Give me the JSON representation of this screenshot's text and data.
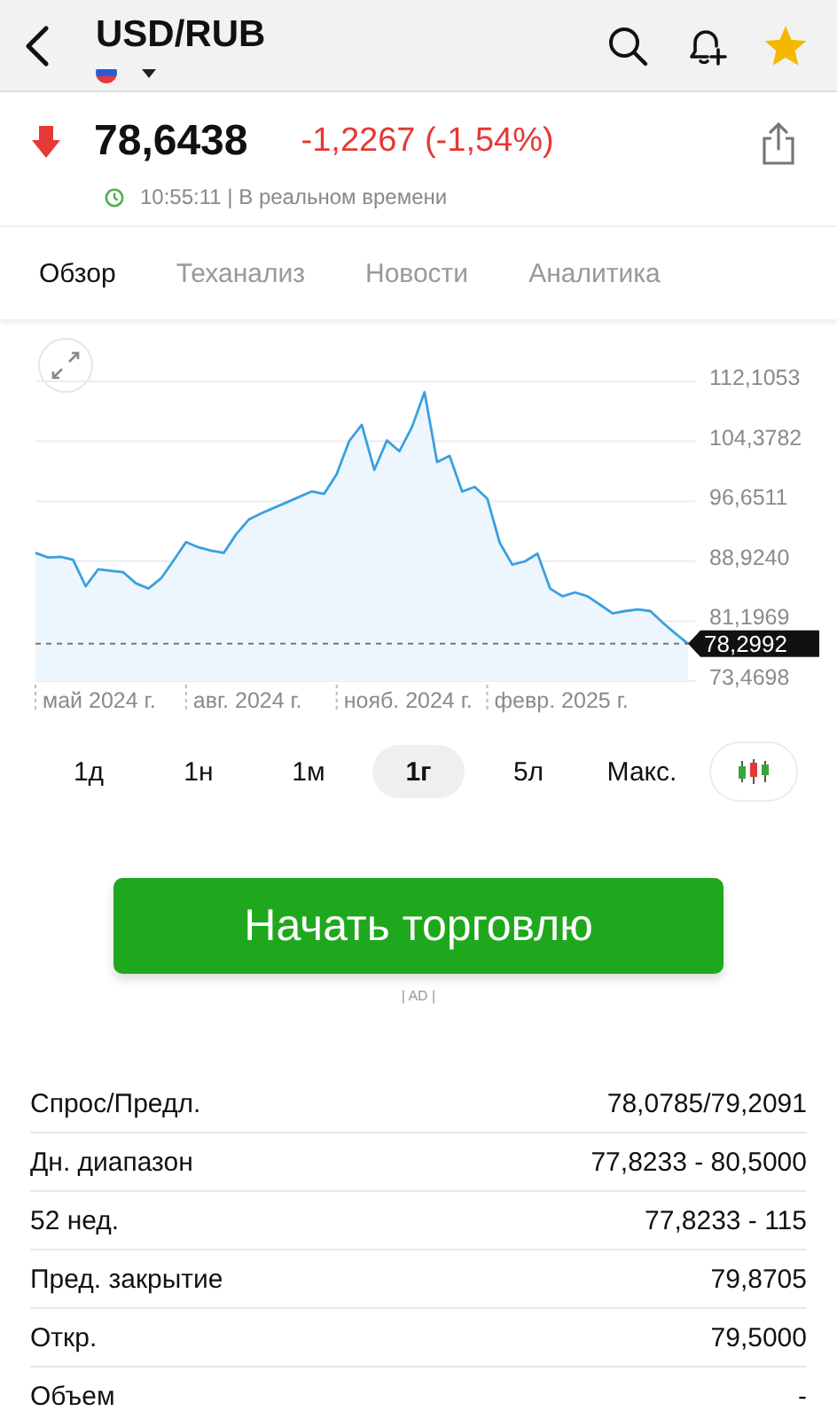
{
  "header": {
    "title": "USD/RUB"
  },
  "quote": {
    "price": "78,6438",
    "change": "-1,2267 (-1,54%)",
    "down": true,
    "time": "10:55:11 | В реальном времени"
  },
  "tabs": [
    {
      "label": "Обзор",
      "selected": true
    },
    {
      "label": "Теханализ",
      "selected": false
    },
    {
      "label": "Новости",
      "selected": false
    },
    {
      "label": "Аналитика",
      "selected": false
    }
  ],
  "chart": {
    "current_value": "78,2992",
    "y_labels": [
      "112,1053",
      "104,3782",
      "96,6511",
      "88,9240",
      "81,1969",
      "73,4698"
    ],
    "x_labels": [
      "май 2024 г.",
      "авг. 2024 г.",
      "нояб. 2024 г.",
      "февр. 2025 г."
    ]
  },
  "ranges": [
    {
      "label": "1д",
      "selected": false
    },
    {
      "label": "1н",
      "selected": false
    },
    {
      "label": "1м",
      "selected": false
    },
    {
      "label": "1г",
      "selected": true
    },
    {
      "label": "5л",
      "selected": false
    },
    {
      "label": "Макс.",
      "selected": false
    }
  ],
  "trade_button": "Начать торговлю",
  "ad_label": "| AD |",
  "stats": [
    {
      "label": "Спрос/Предл.",
      "value": "78,0785/79,2091"
    },
    {
      "label": "Дн. диапазон",
      "value": "77,8233 - 80,5000"
    },
    {
      "label": "52 нед.",
      "value": "77,8233 - 115"
    },
    {
      "label": "Пред. закрытие",
      "value": "79,8705"
    },
    {
      "label": "Откр.",
      "value": "79,5000"
    },
    {
      "label": "Объем",
      "value": "-"
    }
  ]
}
